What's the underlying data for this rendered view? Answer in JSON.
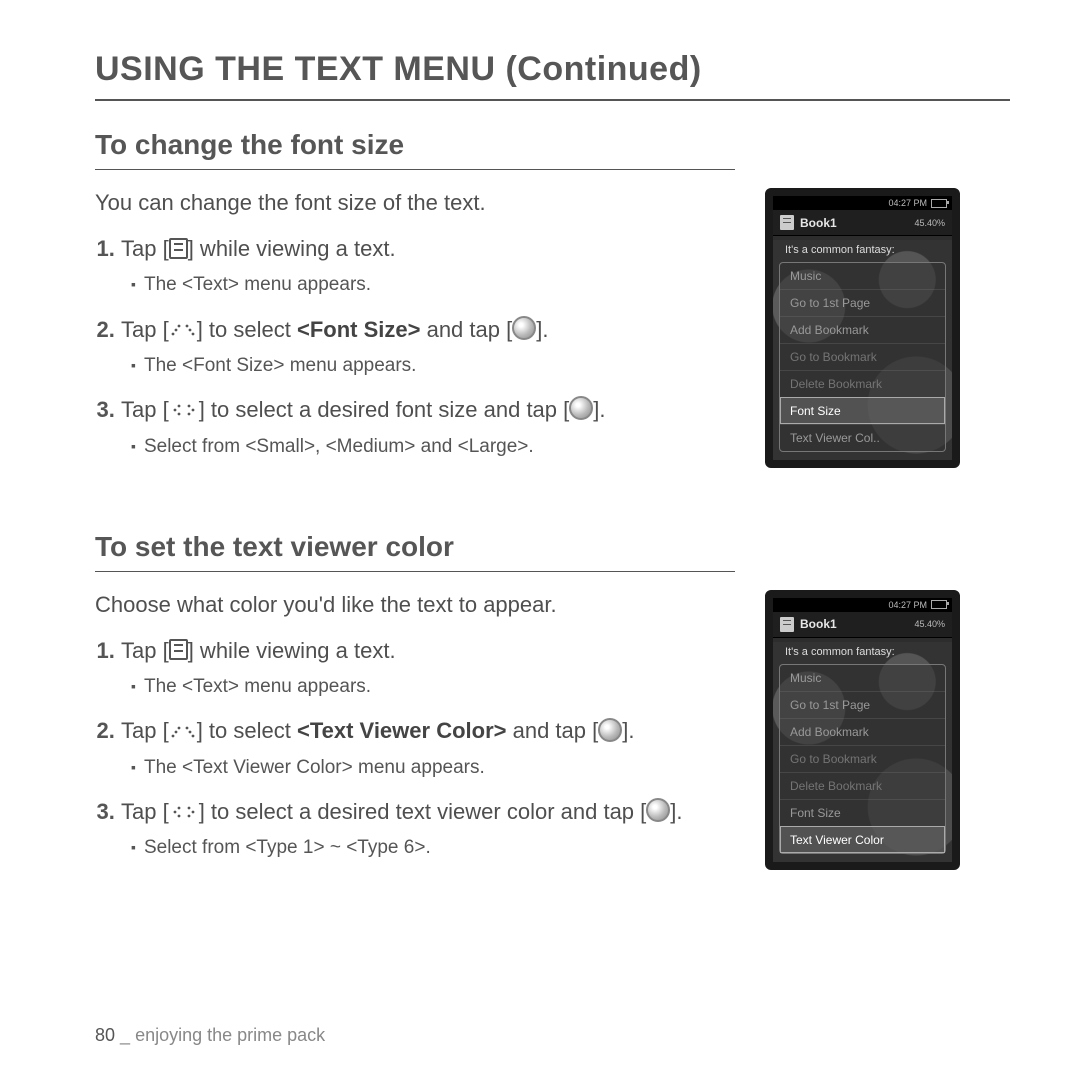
{
  "page_title": "USING THE TEXT MENU (Continued)",
  "footer": {
    "page_no": "80",
    "sep": "_",
    "caption": "enjoying the prime pack"
  },
  "section1": {
    "title": "To change the font size",
    "intro": "You can change the font size of the text.",
    "steps": [
      {
        "pre": "Tap [",
        "icon": "menu",
        "post": "] while viewing a text.",
        "sub": "The <Text> menu appears."
      },
      {
        "pre": "Tap [",
        "icon": "updown",
        "mid": "] to select ",
        "bold": "<Font Size>",
        "post2": " and tap [",
        "icon2": "ok",
        "post3": "].",
        "sub": "The <Font Size> menu appears."
      },
      {
        "pre": "Tap [",
        "icon": "lr",
        "mid": "] to select a desired font size and tap [",
        "icon2": "ok",
        "post3": "].",
        "sub": "Select from <Small>, <Medium> and <Large>."
      }
    ],
    "device": {
      "time": "04:27 PM",
      "title": "Book1",
      "pct": "45.40%",
      "caption": "It's a common fantasy:",
      "items": [
        {
          "label": "Music",
          "cls": ""
        },
        {
          "label": "Go to 1st Page",
          "cls": ""
        },
        {
          "label": "Add Bookmark",
          "cls": ""
        },
        {
          "label": "Go to Bookmark",
          "cls": "dim"
        },
        {
          "label": "Delete Bookmark",
          "cls": "dim"
        },
        {
          "label": "Font Size",
          "cls": "sel"
        },
        {
          "label": "Text Viewer Col..",
          "cls": ""
        }
      ]
    }
  },
  "section2": {
    "title": "To set the text viewer color",
    "intro": "Choose what color you'd like the text to appear.",
    "steps": [
      {
        "pre": "Tap [",
        "icon": "menu",
        "post": "] while viewing a text.",
        "sub": "The <Text> menu appears."
      },
      {
        "pre": "Tap [",
        "icon": "updown",
        "mid": "] to select ",
        "bold": "<Text Viewer Color>",
        "post2": " and tap [",
        "icon2": "ok",
        "post3": "].",
        "sub": "The <Text Viewer Color> menu appears."
      },
      {
        "pre": "Tap [",
        "icon": "lr",
        "mid": "] to select a desired text viewer color and tap [",
        "icon2": "ok",
        "post3": "].",
        "sub": "Select from <Type 1> ~ <Type 6>."
      }
    ],
    "device": {
      "time": "04:27 PM",
      "title": "Book1",
      "pct": "45.40%",
      "caption": "It's a common fantasy:",
      "items": [
        {
          "label": "Music",
          "cls": ""
        },
        {
          "label": "Go to 1st Page",
          "cls": ""
        },
        {
          "label": "Add Bookmark",
          "cls": ""
        },
        {
          "label": "Go to Bookmark",
          "cls": "dim"
        },
        {
          "label": "Delete Bookmark",
          "cls": "dim"
        },
        {
          "label": "Font Size",
          "cls": ""
        },
        {
          "label": "Text Viewer Color",
          "cls": "sel"
        }
      ]
    }
  }
}
